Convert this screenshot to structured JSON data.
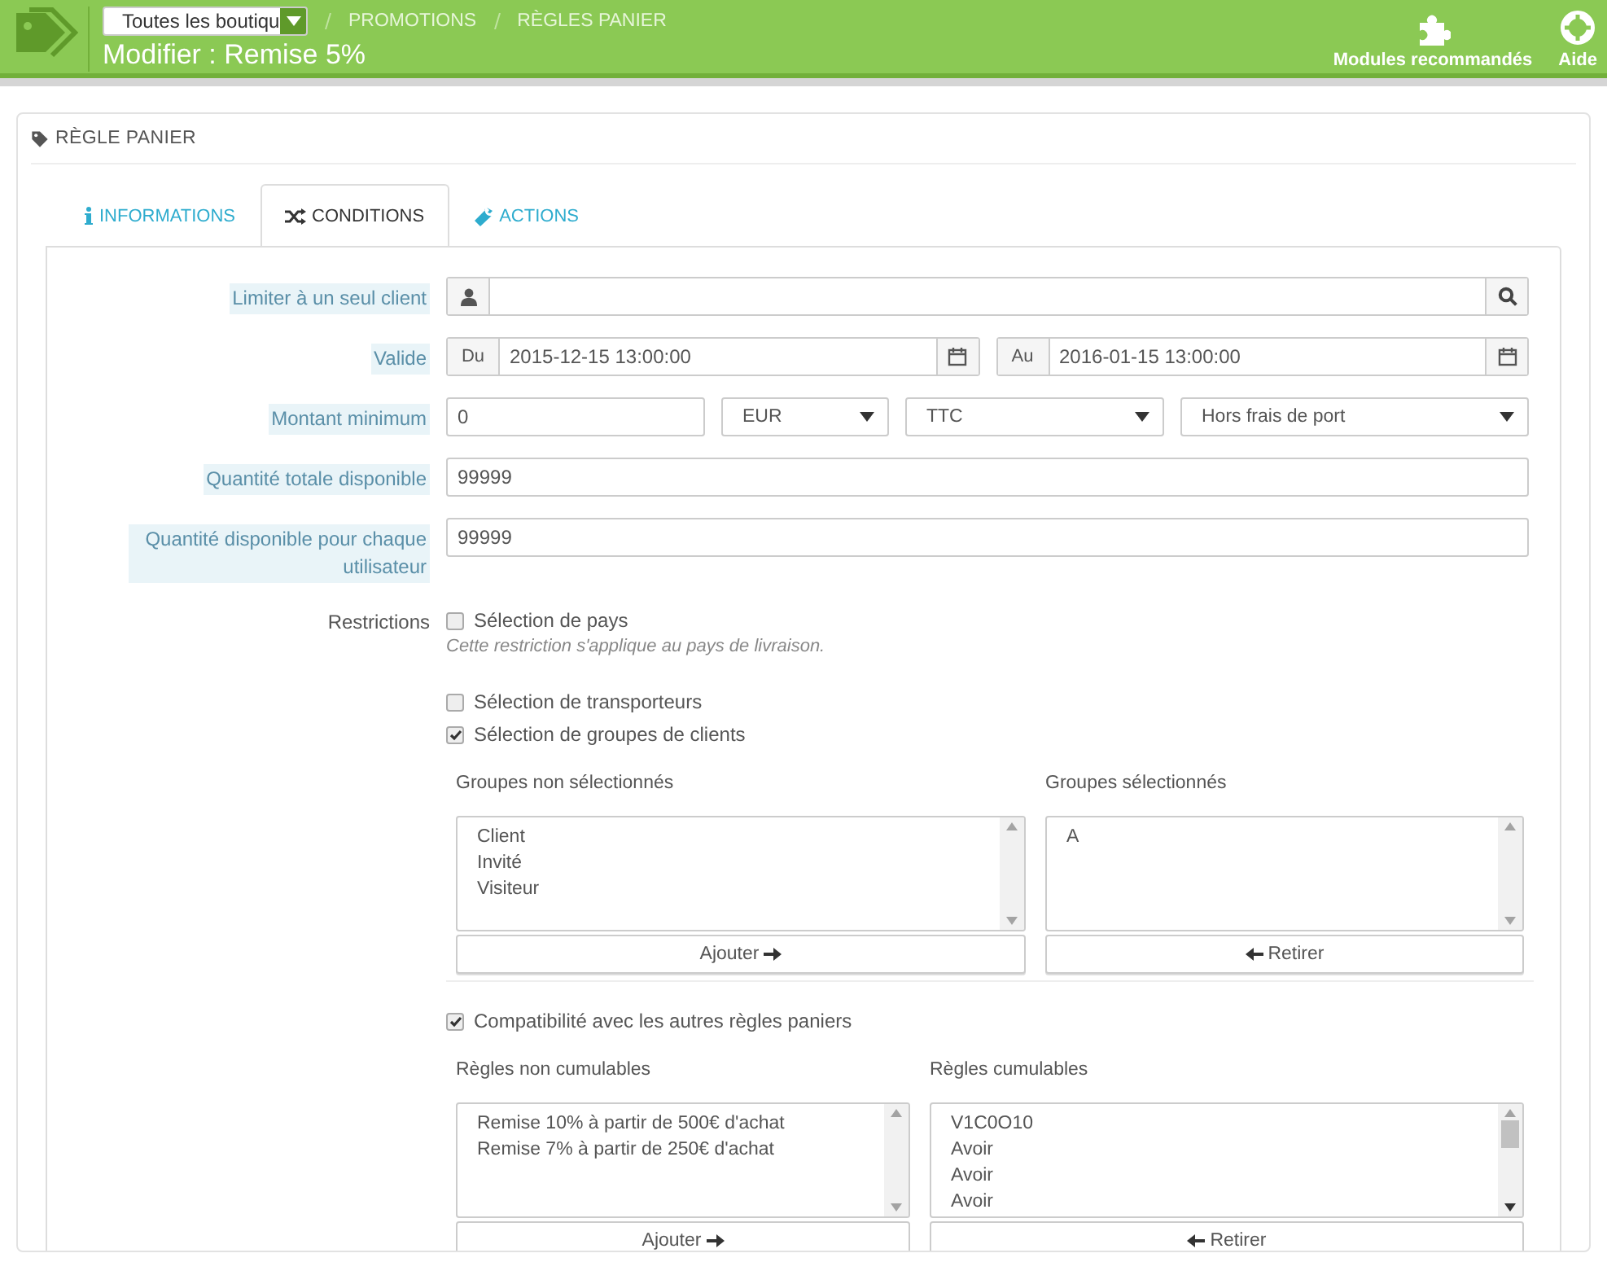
{
  "header": {
    "shop_select": "Toutes les boutiqu",
    "breadcrumb": [
      "PROMOTIONS",
      "RÈGLES PANIER"
    ],
    "title": "Modifier : Remise 5%",
    "actions": [
      {
        "kind": "modules",
        "label": "Modules recommandés"
      },
      {
        "kind": "help",
        "label": "Aide"
      }
    ]
  },
  "panel": {
    "title": "RÈGLE PANIER"
  },
  "tabs": [
    {
      "kind": "info",
      "label": "INFORMATIONS",
      "selected": false
    },
    {
      "kind": "conditions",
      "label": "CONDITIONS",
      "selected": true
    },
    {
      "kind": "actions",
      "label": "ACTIONS",
      "selected": false
    }
  ],
  "fields": [
    {
      "kind": "customer",
      "label": "Limiter à un seul client"
    },
    {
      "kind": "daterange",
      "label": "Valide",
      "from_prefix": "Du",
      "from": "2015-12-15 13:00:00",
      "to_prefix": "Au",
      "to": "2016-01-15 13:00:00"
    },
    {
      "kind": "amount",
      "label": "Montant minimum",
      "value": "0",
      "selects": [
        "EUR",
        "TTC",
        "Hors frais de port"
      ]
    },
    {
      "kind": "text",
      "label": "Quantité totale disponible",
      "value": "99999"
    },
    {
      "kind": "text",
      "label": "Quantité disponible pour chaque utilisateur",
      "value": "99999"
    }
  ],
  "restrictions": {
    "label": "Restrictions",
    "options": [
      {
        "label": "Sélection de pays",
        "checked": false,
        "hint": "Cette restriction s'applique au pays de livraison."
      },
      {
        "label": "Sélection de transporteurs",
        "checked": false
      },
      {
        "label": "Sélection de groupes de clients",
        "checked": true
      }
    ]
  },
  "group_picker": {
    "left": {
      "title": "Groupes non sélectionnés",
      "items": [
        "Client",
        "Invité",
        "Visiteur"
      ]
    },
    "right": {
      "title": "Groupes sélectionnés",
      "items": [
        "A"
      ]
    },
    "add_button": "Ajouter",
    "remove_button": "Retirer"
  },
  "compatibility": {
    "label": "Compatibilité avec les autres règles paniers",
    "checked": true
  },
  "rule_picker": {
    "left": {
      "title": "Règles non cumulables",
      "items": [
        "Remise 10% à partir de 500€ d'achat",
        "Remise 7% à partir de 250€ d'achat"
      ]
    },
    "right": {
      "title": "Règles cumulables",
      "items": [
        "V1C0O10",
        "Avoir",
        "Avoir",
        "Avoir"
      ]
    },
    "add_button": "Ajouter",
    "remove_button": "Retirer"
  }
}
